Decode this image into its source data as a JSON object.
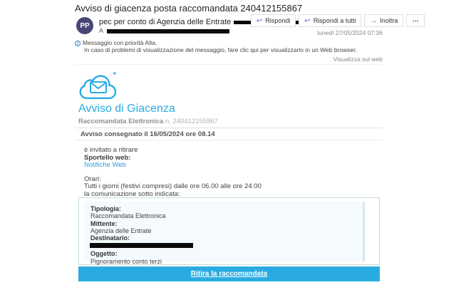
{
  "subject": "Avviso di giacenza posta raccomandata 240412155867",
  "header": {
    "avatar_initials": "PP",
    "sender": "pec per conto di Agenzia delle Entrate",
    "to_label": "A",
    "date": "lunedì 27/05/2024 07:36",
    "actions": {
      "reply": "Rispondi",
      "reply_all": "Rispondi a tutti",
      "forward": "Inoltra",
      "more": "⋯"
    }
  },
  "icons": {
    "reply": "↩",
    "reply_all": "↩",
    "forward": "→",
    "info": "i"
  },
  "notice": {
    "line1": "Messaggio con priorità Alta.",
    "line2": "In caso di problemi di visualizzazione del messaggio, fare clic qui per visualizzarlo in un Web browser."
  },
  "view_on_web": "Visualizza sul web",
  "body": {
    "brand_title": "Avviso di Giacenza",
    "brand_sub_bold": "Raccomandata Elettronica",
    "brand_sub_rest": " n. 240412155867",
    "delivered": "Avviso consegnato il 16/05/2024 ore 08.14",
    "invite": "è invitato a ritirare",
    "sportello_label": "Sportello web:",
    "sportello_link": "Notifiche Web",
    "orari_label": "Orari:",
    "orari_text": "Tutti i giorni (festivi compresi) dalle ore 06.00 alle ore 24.00",
    "comunicazione": "la comunicazione sotto indicata:",
    "details": [
      {
        "label": "Tipologia:",
        "value": "Raccomandata Elettronica"
      },
      {
        "label": "Mittente:",
        "value": "Agenzia delle Entrate"
      },
      {
        "label": "Destinatario:",
        "value": ""
      },
      {
        "label": "Oggetto:",
        "value": "Pignoramento conto terzi"
      }
    ],
    "cta": "Ritira la raccomandata"
  },
  "colors": {
    "accent_blue": "#29abe2",
    "link_blue": "#2e9bd6",
    "avatar_bg": "#464775",
    "icon_purple": "#8661c5",
    "redaction": "#0b0b0b"
  }
}
